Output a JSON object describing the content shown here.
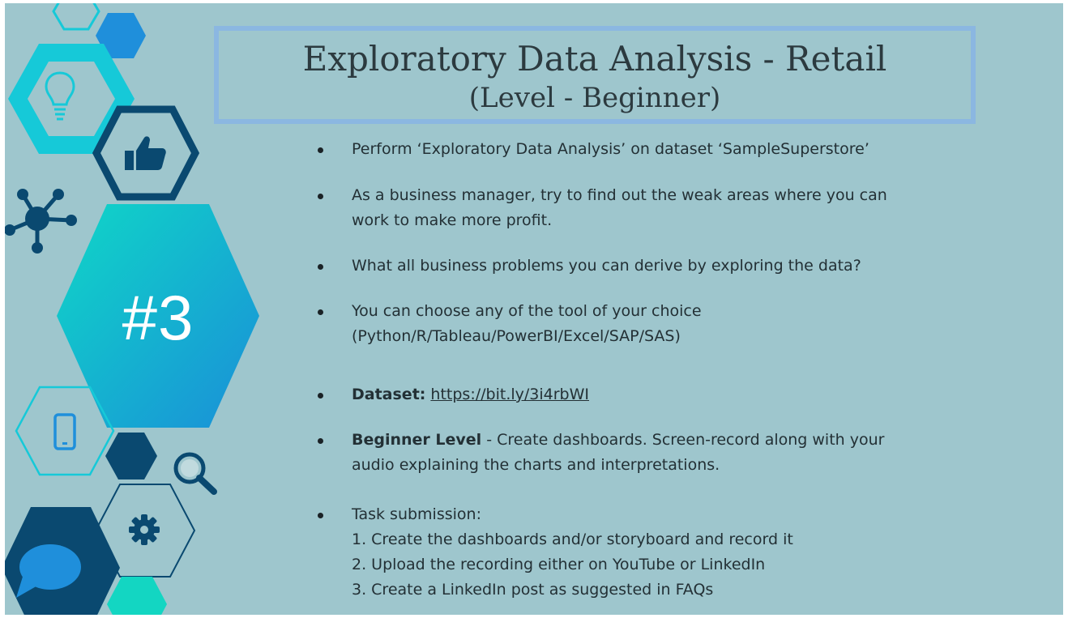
{
  "slide": {
    "title": "Exploratory Data Analysis - Retail",
    "subtitle": "(Level - Beginner)",
    "number": "#3",
    "colors": {
      "background": "#9ec6cd",
      "title_border": "#8bb7e1",
      "cyan": "#16c9d8",
      "teal": "#13d6c2",
      "navy": "#0a4970",
      "blue": "#1f8fdb",
      "text": "#233035"
    },
    "icons": [
      "lightbulb-icon",
      "thumbs-up-icon",
      "network-icon",
      "phone-icon",
      "magnifier-icon",
      "gear-icon",
      "chat-bubble-icon"
    ]
  },
  "bullets": [
    {
      "lines": [
        "Perform ‘Exploratory Data Analysis’ on dataset  ‘SampleSuperstore’"
      ]
    },
    {
      "lines": [
        "As a business manager, try to find out the weak areas where you can",
        "work to make more profit."
      ]
    },
    {
      "lines": [
        "What all business problems you can derive by exploring the  data?"
      ]
    },
    {
      "lines": [
        "You can choose any of the tool of your choice",
        "(Python/R/Tableau/PowerBI/Excel/SAP/SAS)"
      ]
    },
    {
      "label": "Dataset:",
      "link": "https://bit.ly/3i4rbWI"
    },
    {
      "label": "Beginner Level",
      "rest": " - Create dashboards. Screen-record along with your",
      "line2": "audio explaining the charts and interpretations."
    },
    {
      "lines": [
        "Task submission:",
        "1. Create the dashboards and/or storyboard and record it",
        "2. Upload the recording either on YouTube or LinkedIn",
        "3. Create a LinkedIn post as suggested in FAQs"
      ]
    }
  ]
}
